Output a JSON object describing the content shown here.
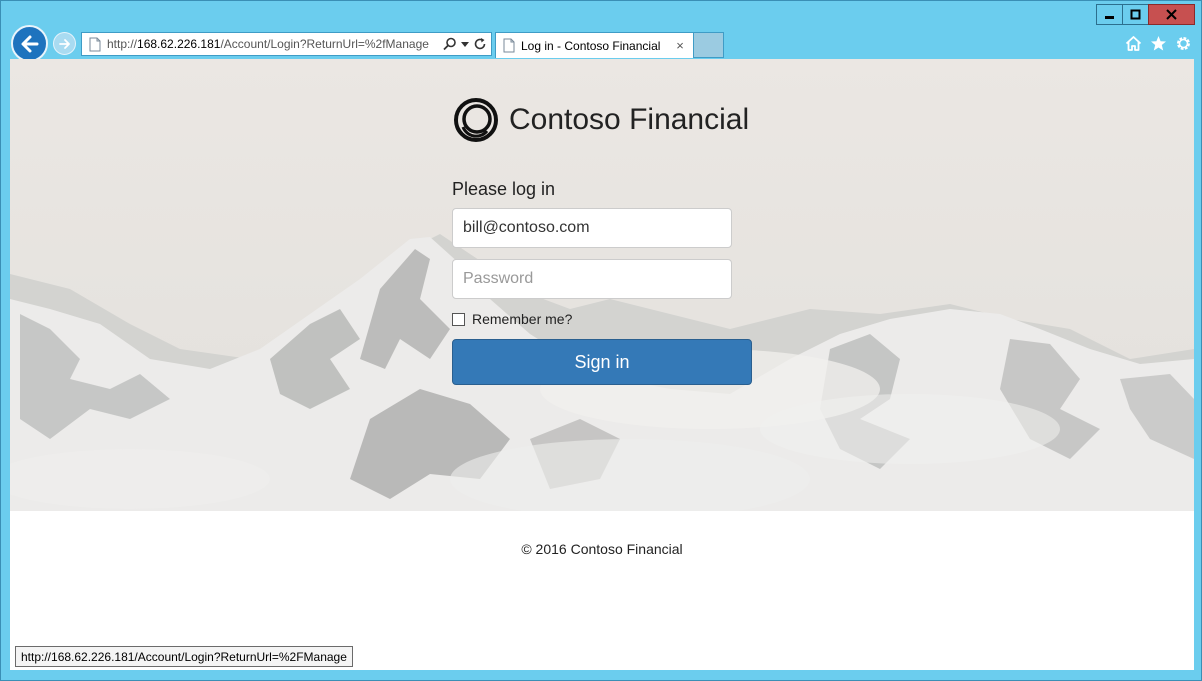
{
  "browser": {
    "address": {
      "prefix": "http://",
      "host": "168.62.226.181",
      "path": "/Account/Login?ReturnUrl=%2fManage"
    },
    "tab": {
      "title": "Log in - Contoso Financial",
      "close_glyph": "×"
    },
    "window_controls": [
      "minimize-icon",
      "maximize-icon",
      "close-icon"
    ],
    "toolbar_icons": [
      "home-icon",
      "star-icon",
      "gear-icon"
    ],
    "status_url": "http://168.62.226.181/Account/Login?ReturnUrl=%2FManage",
    "accent_color": "#6bcdee"
  },
  "page": {
    "brand": "Contoso Financial",
    "login_heading": "Please log in",
    "email_value": "bill@contoso.com",
    "password_placeholder": "Password",
    "remember_label": "Remember me?",
    "remember_checked": false,
    "signin_label": "Sign in",
    "signin_color": "#3479b7",
    "footer": "© 2016 Contoso Financial"
  }
}
